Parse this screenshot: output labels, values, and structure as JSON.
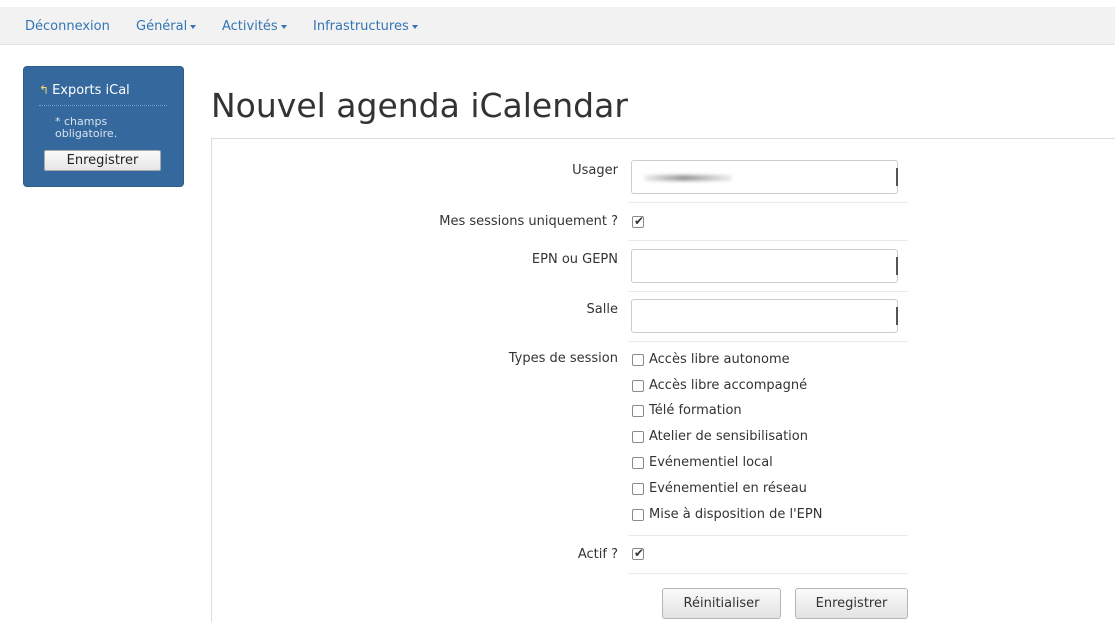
{
  "nav": {
    "items": [
      {
        "label": "Déconnexion",
        "dropdown": false
      },
      {
        "label": "Général",
        "dropdown": true
      },
      {
        "label": "Activités",
        "dropdown": true
      },
      {
        "label": "Infrastructures",
        "dropdown": true
      }
    ]
  },
  "sidebar": {
    "title": "Exports iCal",
    "note": "* champs obligatoire.",
    "save_label": "Enregistrer"
  },
  "page": {
    "title": "Nouvel agenda iCalendar"
  },
  "form": {
    "usager": {
      "label": "Usager",
      "value": ""
    },
    "mes_sessions": {
      "label": "Mes sessions uniquement ?",
      "checked": true
    },
    "epn": {
      "label": "EPN ou GEPN",
      "value": ""
    },
    "salle": {
      "label": "Salle",
      "value": ""
    },
    "types": {
      "label": "Types de session",
      "options": [
        {
          "label": "Accès libre autonome",
          "checked": false
        },
        {
          "label": "Accès libre accompagné",
          "checked": false
        },
        {
          "label": "Télé formation",
          "checked": false
        },
        {
          "label": "Atelier de sensibilisation",
          "checked": false
        },
        {
          "label": "Evénementiel local",
          "checked": false
        },
        {
          "label": "Evénementiel en réseau",
          "checked": false
        },
        {
          "label": "Mise à disposition de l'EPN",
          "checked": false
        }
      ]
    },
    "actif": {
      "label": "Actif ?",
      "checked": true
    },
    "reset_label": "Réinitialiser",
    "submit_label": "Enregistrer"
  }
}
